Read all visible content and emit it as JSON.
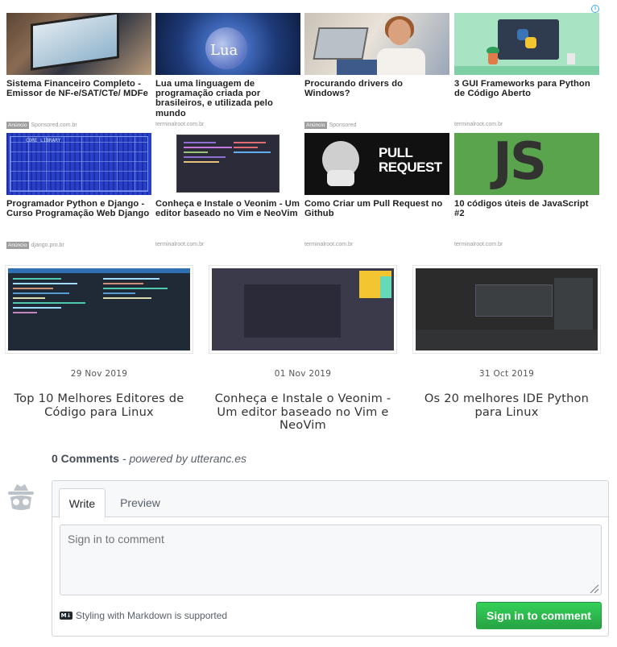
{
  "ads": {
    "rows": [
      [
        {
          "title": "Sistema Financeiro Completo - Emissor de NF-e/SAT/CTe/ MDFe",
          "sponsored": true,
          "badge": "Anúncio",
          "source": "Sponsored.com.br"
        },
        {
          "title": "Lua uma linguagem de programação criada por brasileiros, e utilizada pelo mundo",
          "sponsored": false,
          "badge": "",
          "source": "terminalroot.com.br"
        },
        {
          "title": "Procurando drivers do Windows?",
          "sponsored": true,
          "badge": "Anúncio",
          "source": "Sponsored"
        },
        {
          "title": "3 GUI Frameworks para Python de Código Aberto",
          "sponsored": false,
          "badge": "",
          "source": "terminalroot.com.br"
        }
      ],
      [
        {
          "title": "Programador Python e Django - Curso Programação Web Django",
          "sponsored": true,
          "badge": "Anúncio",
          "source": "django.pro.br"
        },
        {
          "title": "Conheça e Instale o Veonim - Um editor baseado no Vim e NeoVim",
          "sponsored": false,
          "badge": "",
          "source": "terminalroot.com.br"
        },
        {
          "title": "Como Criar um Pull Request no Github",
          "sponsored": false,
          "badge": "",
          "source": "terminalroot.com.br"
        },
        {
          "title": "10 códigos úteis de JavaScript #2",
          "sponsored": false,
          "badge": "",
          "source": "terminalroot.com.br"
        }
      ]
    ],
    "thumb_text": {
      "lua": "Lua",
      "pull": "PULL\nREQUEST",
      "js": "JS"
    }
  },
  "related": [
    {
      "date": "29 Nov 2019",
      "title": "Top 10 Melhores Editores de Código para Linux"
    },
    {
      "date": "01 Nov 2019",
      "title": "Conheça e Instale o Veonim - Um editor baseado no Vim e NeoVim"
    },
    {
      "date": "31 Oct 2019",
      "title": "Os 20 melhores IDE Python para Linux"
    }
  ],
  "comments": {
    "count_label": "0 Comments",
    "powered_by": "- powered by utteranc.es",
    "tabs": {
      "write": "Write",
      "preview": "Preview"
    },
    "placeholder": "Sign in to comment",
    "markdown_icon": "M↓",
    "markdown_note": "Styling with Markdown is supported",
    "submit_label": "Sign in to comment",
    "button_color": "#2ea44f"
  }
}
